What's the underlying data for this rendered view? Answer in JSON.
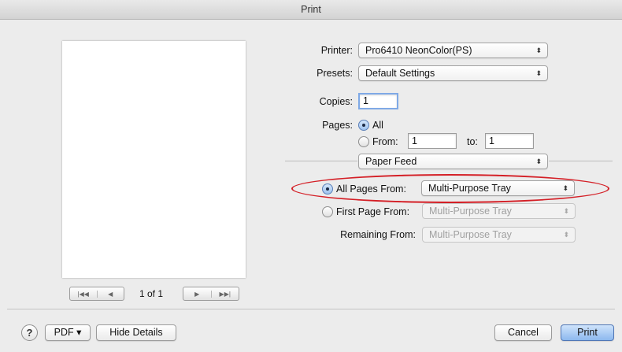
{
  "window": {
    "title": "Print"
  },
  "preview": {
    "page_info": "1 of 1",
    "nav": {
      "first_icon": "|◀◀",
      "prev_icon": "◀",
      "next_icon": "▶",
      "last_icon": "▶▶|"
    }
  },
  "printer": {
    "label": "Printer:",
    "value": "Pro6410 NeonColor(PS)"
  },
  "presets": {
    "label": "Presets:",
    "value": "Default Settings"
  },
  "copies": {
    "label": "Copies:",
    "value": "1"
  },
  "pages": {
    "label": "Pages:",
    "all_label": "All",
    "from_label": "From:",
    "from_value": "1",
    "to_label": "to:",
    "to_value": "1",
    "selected": "all"
  },
  "panel_select": {
    "value": "Paper Feed"
  },
  "paper_feed": {
    "all_pages_label": "All Pages From:",
    "all_pages_value": "Multi-Purpose Tray",
    "first_page_label": "First Page From:",
    "first_page_value": "Multi-Purpose Tray",
    "remaining_label": "Remaining From:",
    "remaining_value": "Multi-Purpose Tray",
    "selected": "all"
  },
  "bottom": {
    "help_label": "?",
    "pdf_label": "PDF ▾",
    "hide_details_label": "Hide Details",
    "cancel_label": "Cancel",
    "print_label": "Print"
  },
  "colors": {
    "highlight": "#d41f26",
    "accent": "#7fa9e6"
  }
}
